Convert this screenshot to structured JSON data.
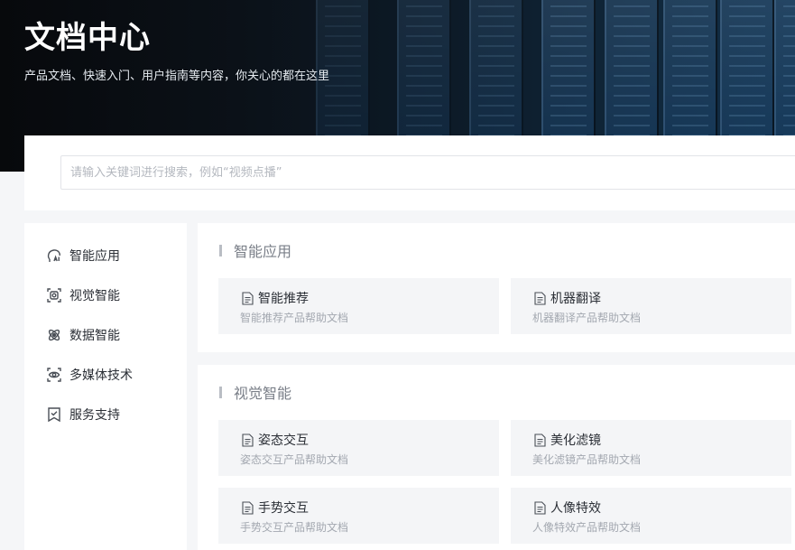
{
  "hero": {
    "title": "文档中心",
    "subtitle": "产品文档、快速入门、用户指南等内容，你关心的都在这里"
  },
  "search": {
    "placeholder": "请输入关键词进行搜索，例如“视频点播”"
  },
  "sidebar": {
    "items": [
      {
        "label": "智能应用",
        "icon": "ai-head-icon"
      },
      {
        "label": "视觉智能",
        "icon": "vision-scan-icon"
      },
      {
        "label": "数据智能",
        "icon": "atom-icon"
      },
      {
        "label": "多媒体技术",
        "icon": "eye-icon"
      },
      {
        "label": "服务支持",
        "icon": "bookmark-check-icon"
      }
    ]
  },
  "sections": [
    {
      "title": "智能应用",
      "cards": [
        {
          "title": "智能推荐",
          "desc": "智能推荐产品帮助文档"
        },
        {
          "title": "机器翻译",
          "desc": "机器翻译产品帮助文档"
        }
      ]
    },
    {
      "title": "视觉智能",
      "cards": [
        {
          "title": "姿态交互",
          "desc": "姿态交互产品帮助文档"
        },
        {
          "title": "美化滤镜",
          "desc": "美化滤镜产品帮助文档"
        },
        {
          "title": "手势交互",
          "desc": "手势交互产品帮助文档"
        },
        {
          "title": "人像特效",
          "desc": "人像特效产品帮助文档"
        }
      ]
    }
  ],
  "colors": {
    "hero_bg": "#0b1118",
    "text_primary": "#2b2f36",
    "text_muted": "#a3a8b0",
    "card_bg": "#f4f5f7",
    "icon_stroke": "#4a4f57"
  }
}
